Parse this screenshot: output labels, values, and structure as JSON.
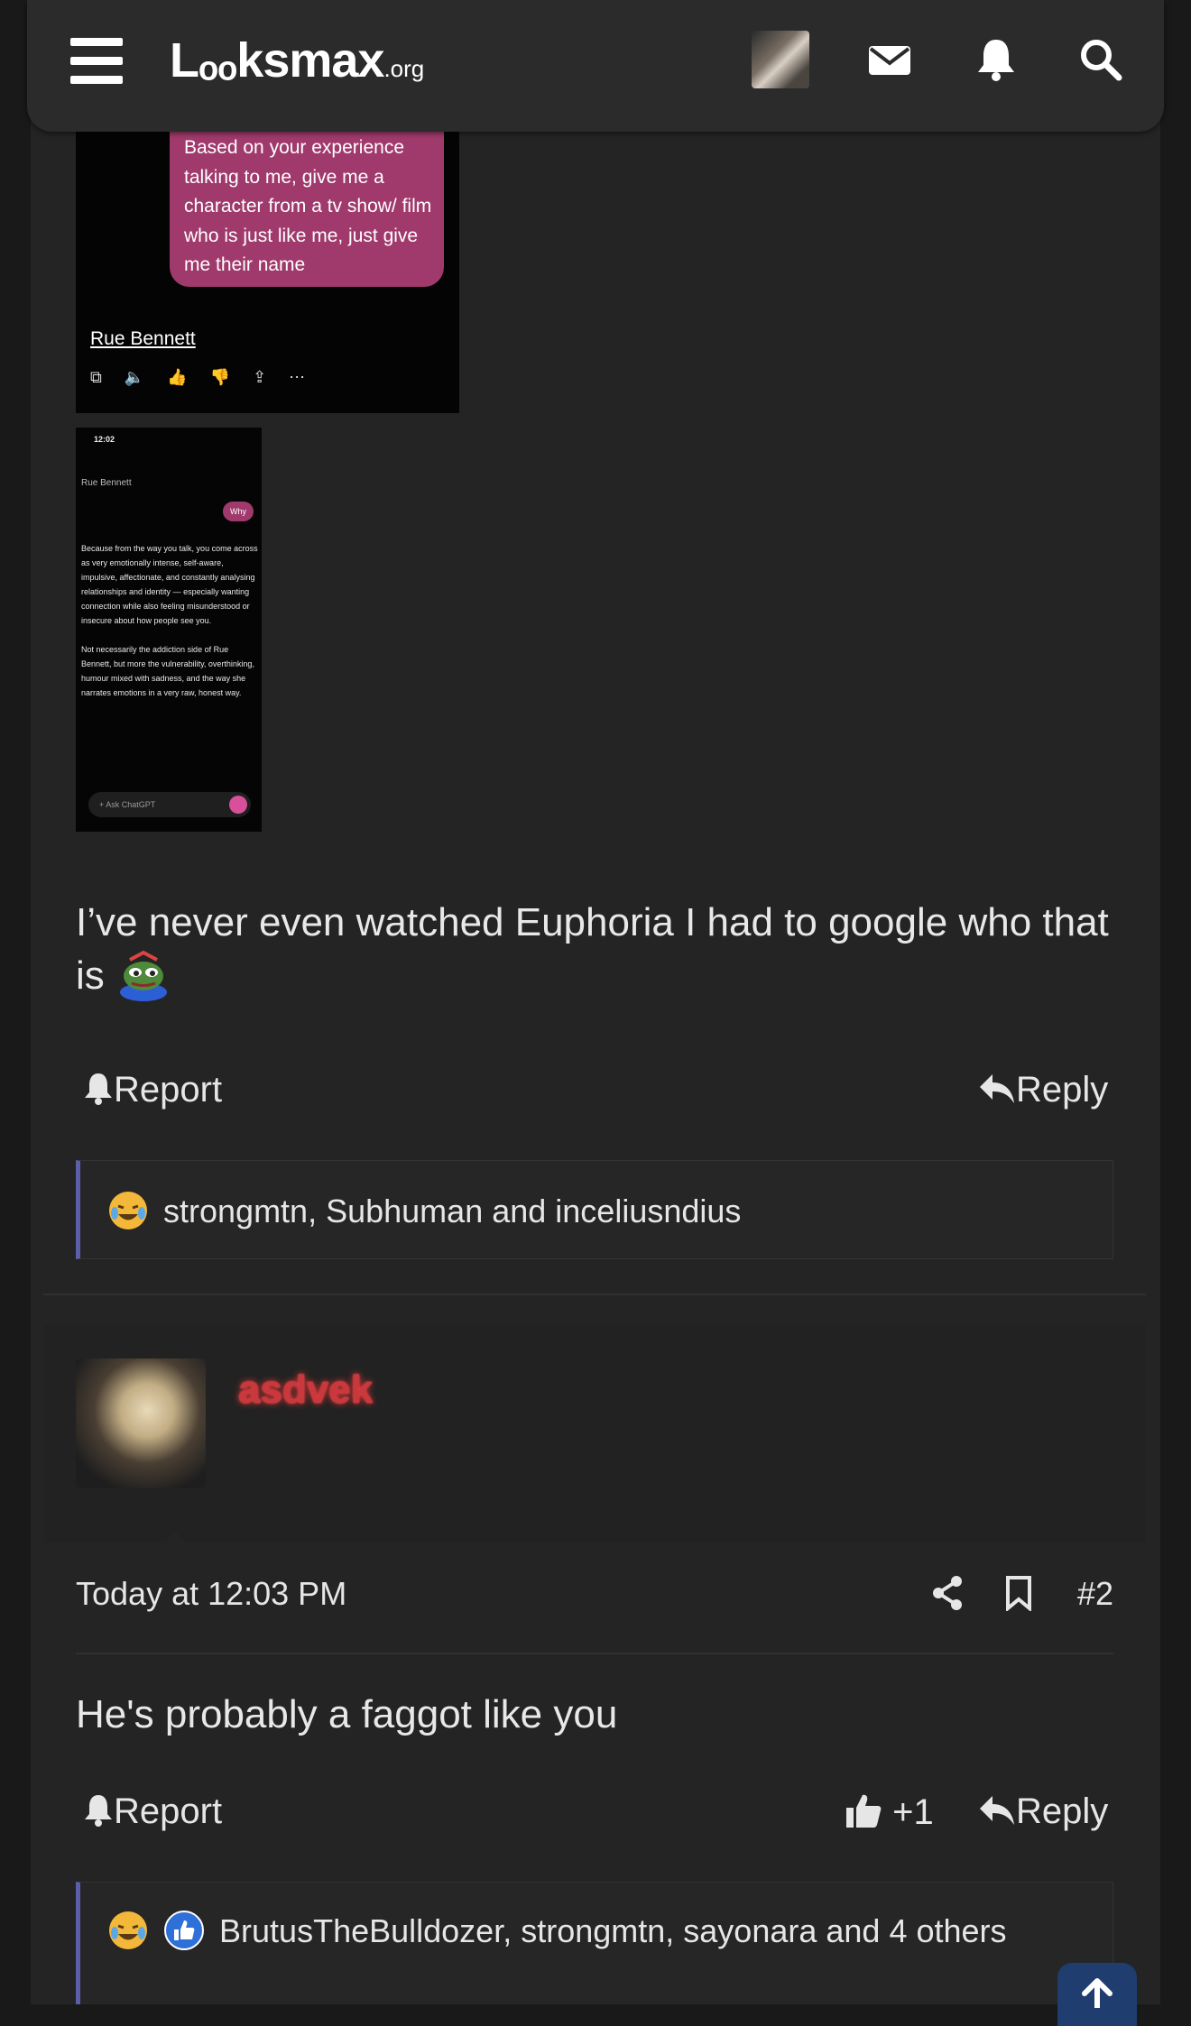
{
  "header": {
    "logo_main": "Lₒₒksmax",
    "logo_suffix": ".org",
    "icons": [
      "menu-icon",
      "avatar",
      "mail-icon",
      "bell-icon",
      "search-icon"
    ]
  },
  "screenshot1": {
    "bubble_text": "Based on your experience talking to me, give me a character from a tv show/ film who is just like me, just give me their name",
    "answer": "Rue Bennett",
    "icons_row": "⧉ 🔈 👍 👎 ⇪ ⋯"
  },
  "screenshot2": {
    "time": "12:02",
    "top_name": "Rue Bennett",
    "why": "Why",
    "body": "Because from the way you talk, you come across as very emotionally intense, self-aware, impulsive, affectionate, and constantly analysing relationships and identity — especially wanting connection while also feeling misunderstood or insecure about how people see you.\n\nNot necessarily the addiction side of Rue Bennett, but more the vulnerability, overthinking, humour mixed with sadness, and the way she narrates emotions in a very raw, honest way.",
    "ask": "+ Ask ChatGPT"
  },
  "post1": {
    "text": "I’ve never even watched Euphoria I had to google who that is",
    "report": "Report",
    "reply": "Reply",
    "reactions": "strongmtn, Subhuman and inceliusndius"
  },
  "post2": {
    "username": "asdvek",
    "time": "Today at 12:03 PM",
    "number": "#2",
    "text": "He's probably a faggot like you",
    "report": "Report",
    "like": "+1",
    "reply": "Reply",
    "reactions": "BrutusTheBulldozer, strongmtn, sayonara and 4 others"
  },
  "colors": {
    "bg": "#191919",
    "panel": "#242424",
    "accent": "#5a5fa8",
    "username": "#c9383c",
    "bubble": "#a03a6c"
  }
}
